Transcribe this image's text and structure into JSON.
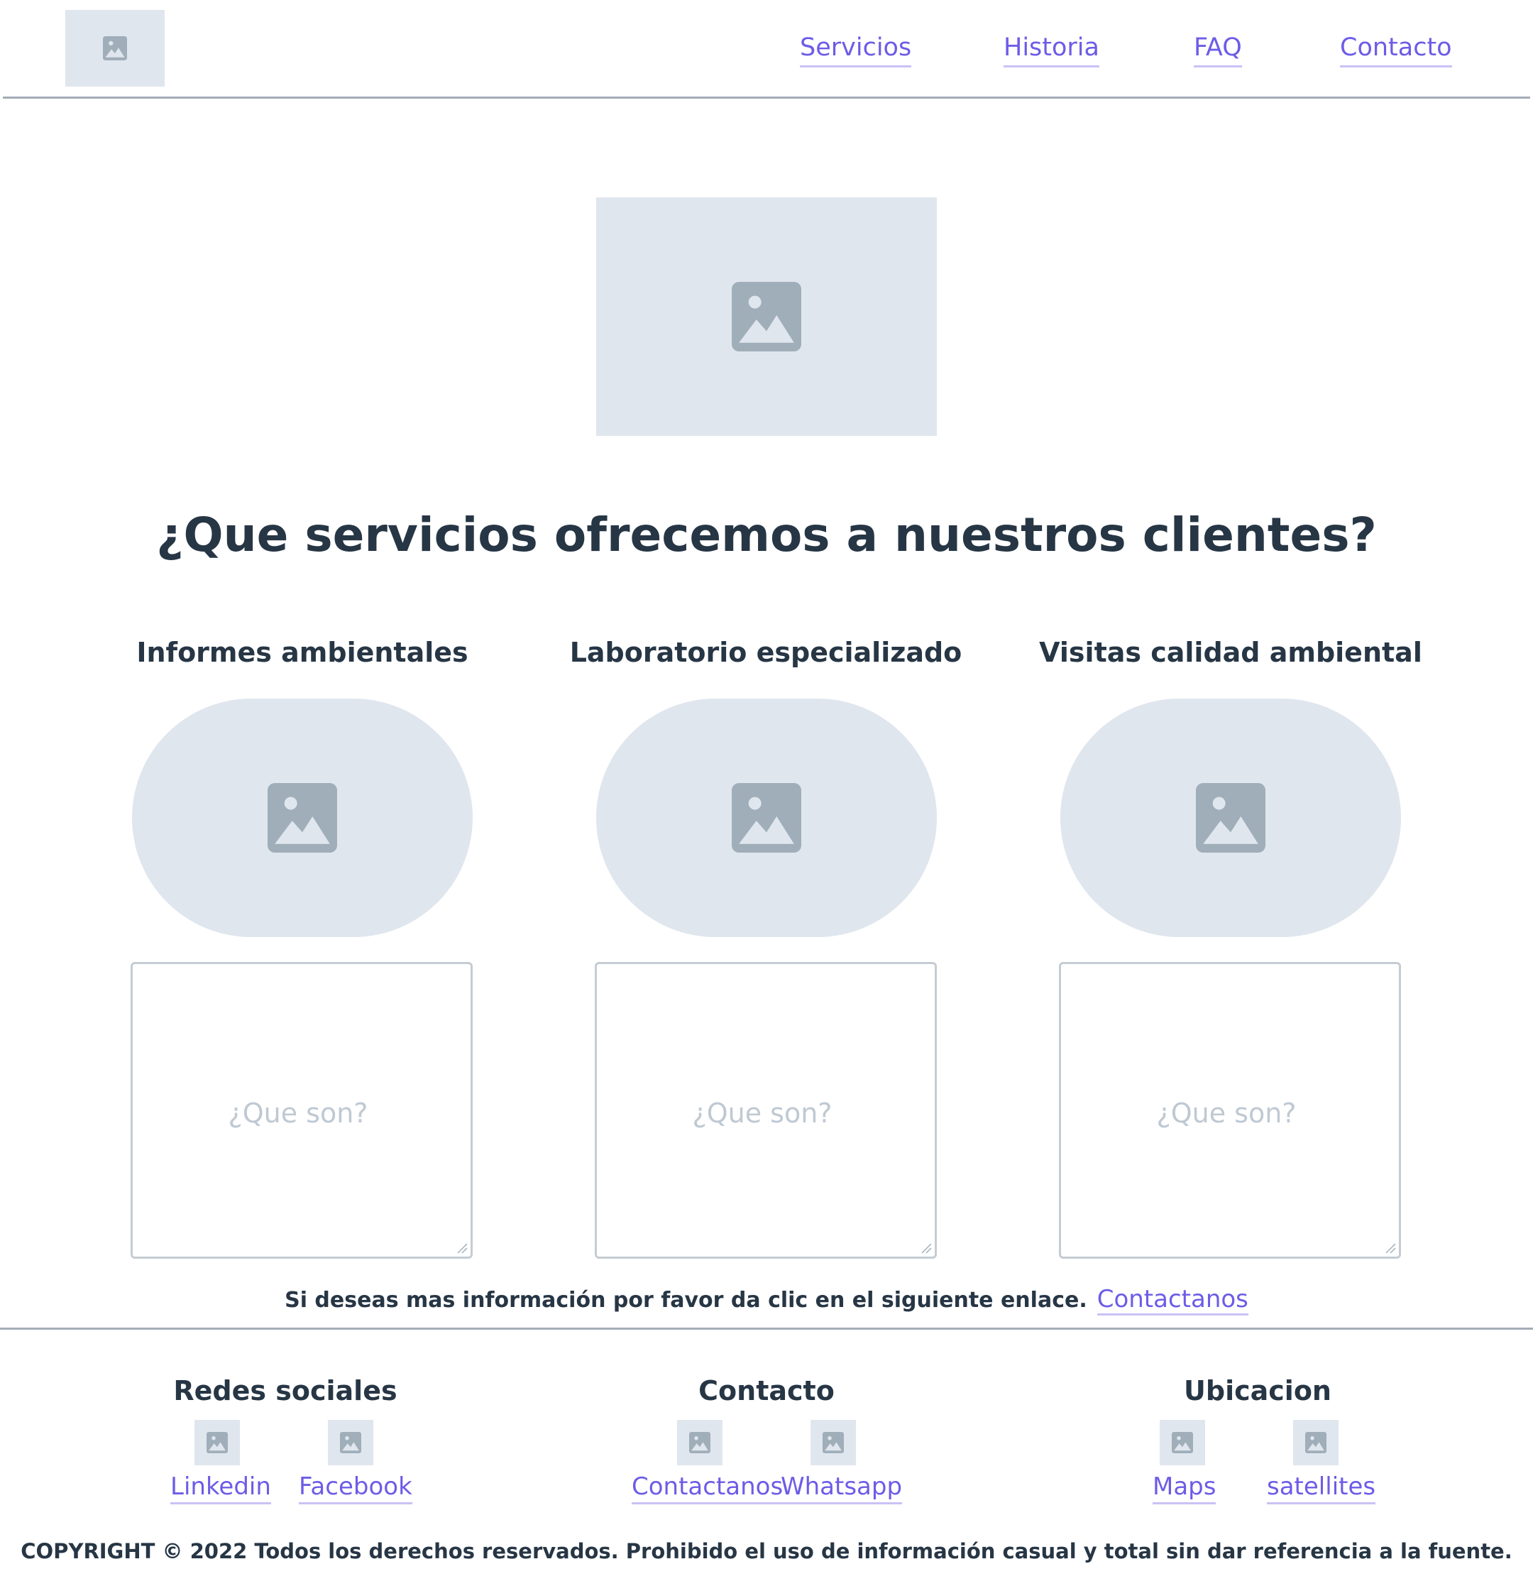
{
  "nav": {
    "items": [
      "Servicios",
      "Historia",
      "FAQ",
      "Contacto"
    ]
  },
  "main": {
    "title": "¿Que servicios ofrecemos a nuestros clientes?",
    "services": [
      {
        "title": "Informes ambientales",
        "placeholder": "¿Que son?"
      },
      {
        "title": "Laboratorio especializado",
        "placeholder": "¿Que son?"
      },
      {
        "title": "Visitas calidad ambiental",
        "placeholder": "¿Que son?"
      }
    ],
    "more_info_text": "Si deseas mas información por favor da clic en el siguiente enlace.",
    "more_info_link": "Contactanos"
  },
  "footer": {
    "columns": [
      {
        "title": "Redes sociales",
        "links": [
          "Linkedin",
          "Facebook"
        ]
      },
      {
        "title": "Contacto",
        "links": [
          "Contactanos",
          "Whatsapp"
        ]
      },
      {
        "title": "Ubicacion",
        "links": [
          "Maps",
          "satellites"
        ]
      }
    ],
    "copyright": "COPYRIGHT © 2022 Todos los derechos reservados. Prohibido el uso de información casual y total sin dar referencia a la fuente."
  },
  "icons": {
    "placeholder": "image-placeholder-icon"
  },
  "colors": {
    "link": "#6c5ce7",
    "placeholder_bg": "#e0e6ee",
    "placeholder_icon": "#a0aeba",
    "text": "#273645"
  }
}
